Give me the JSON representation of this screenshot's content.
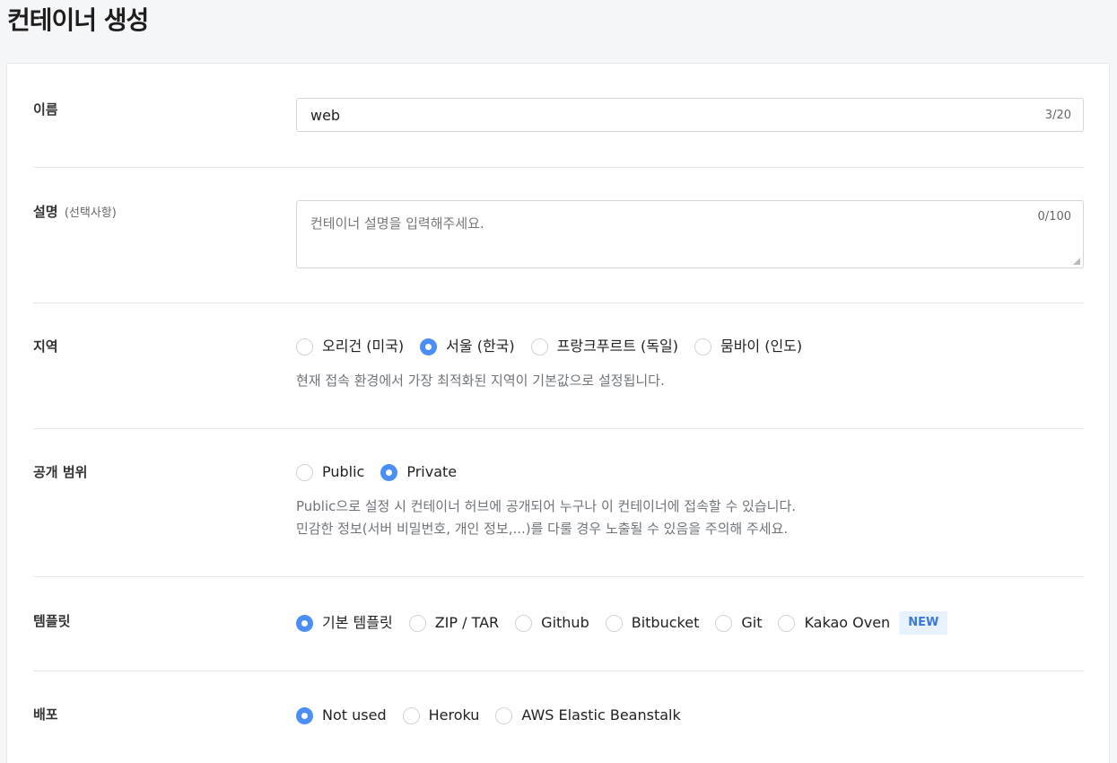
{
  "page": {
    "title": "컨테이너 생성"
  },
  "form": {
    "name": {
      "label": "이름",
      "value": "web",
      "counter": "3/20"
    },
    "description": {
      "label": "설명",
      "optional": "(선택사항)",
      "placeholder": "컨테이너 설명을 입력해주세요.",
      "counter": "0/100"
    },
    "region": {
      "label": "지역",
      "options": [
        "오리건 (미국)",
        "서울 (한국)",
        "프랑크푸르트 (독일)",
        "뭄바이 (인도)"
      ],
      "selected": "서울 (한국)",
      "help": "현재 접속 환경에서 가장 최적화된 지역이 기본값으로 설정됩니다."
    },
    "visibility": {
      "label": "공개 범위",
      "options": [
        "Public",
        "Private"
      ],
      "selected": "Private",
      "help_line1": "Public으로 설정 시 컨테이너 허브에 공개되어 누구나 이 컨테이너에 접속할 수 있습니다.",
      "help_line2": "민감한 정보(서버 비밀번호, 개인 정보,...)를 다룰 경우 노출될 수 있음을 주의해 주세요."
    },
    "template": {
      "label": "템플릿",
      "options": [
        "기본 템플릿",
        "ZIP / TAR",
        "Github",
        "Bitbucket",
        "Git",
        "Kakao Oven"
      ],
      "selected": "기본 템플릿",
      "badge": "NEW"
    },
    "deploy": {
      "label": "배포",
      "options": [
        "Not used",
        "Heroku",
        "AWS Elastic Beanstalk"
      ],
      "selected": "Not used"
    }
  },
  "colors": {
    "accent": "#4b8ef5",
    "badge_bg": "#e8f1fe",
    "badge_text": "#3a78d8"
  }
}
